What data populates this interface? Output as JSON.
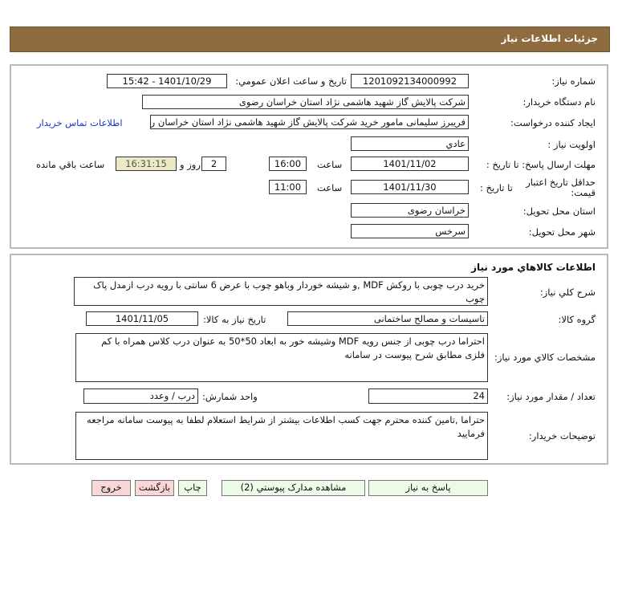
{
  "header": {
    "title": "جزئيات اطلاعات نیاز"
  },
  "info": {
    "need_number_label": "شماره نیاز:",
    "need_number": "1201092134000992",
    "announce_label": "تاريخ و ساعت اعلان عمومي:",
    "announce_value": "1401/10/29 - 15:42",
    "buyer_label": "نام دستگاه خريدار:",
    "buyer_value": "شرکت پالایش گاز شهید هاشمی نژاد   استان خراسان رضوی",
    "creator_label": "ايجاد کننده درخواست:",
    "creator_value": "فریبرز  سلیمانی مامور خرید شرکت پالایش گاز شهید هاشمی نژاد   استان خراسان رضوی",
    "contact_link": "اطلاعات تماس خريدار",
    "priority_label": "اولويت نياز :",
    "priority_value": "عادي",
    "deadline_label": "مهلت ارسال پاسخ: تا تاريخ :",
    "deadline_date": "1401/11/02",
    "time_label": "ساعت",
    "deadline_time": "16:00",
    "days": "2",
    "days_label": "روز و",
    "remaining": "16:31:15",
    "remaining_label": "ساعت باقي مانده",
    "validity_label": "حداقل تاريخ اعتبار قيمت:",
    "validity_to_label": "تا تاريخ :",
    "validity_date": "1401/11/30",
    "validity_time": "11:00",
    "province_label": "استان محل تحويل:",
    "province_value": "خراسان رضوی",
    "city_label": "شهر محل تحويل:",
    "city_value": "سرخس"
  },
  "goods": {
    "title": "اطلاعات کالاهاي مورد نياز",
    "desc_label": "شرح کلي نياز:",
    "desc_value": "خرید درب چوبی با روکش MDF ,و شیشه خوردار وباهو چوب با عرض 6 سانتی  با رویه درب ازمدل پاک چوب",
    "group_label": "گروه کالا:",
    "group_value": "تاسیسات و مصالح ساختمانی",
    "need_date_label": "تاريخ نياز به کالا:",
    "need_date": "1401/11/05",
    "spec_label": "مشخصات کالاي مورد نياز:",
    "spec_value": " احتراما درب چوبی از جنس رویه MDF وشیشه خور به ابعاد 50*50  به عنوان درب کلاس  همراه با کم فلزی  مطابق شرح پیوست در سامانه",
    "qty_label": "تعداد / مقدار مورد نياز:",
    "qty_value": "24",
    "unit_label": "واحد شمارش:",
    "unit_value": "درب / وعدد",
    "notes_label": "توضيحات خريدار:",
    "notes_value": "حتراما ,تامین کننده محترم جهت کسب اطلاعات بیشتر از شرایط استعلام لطفا به پیوست سامانه مراجعه فرمایید"
  },
  "buttons": {
    "reply": "پاسخ به نياز",
    "docs": "مشاهده مدارک پيوستي (2)",
    "print": "چاپ",
    "back": "بازگشت",
    "exit": "خروج"
  }
}
